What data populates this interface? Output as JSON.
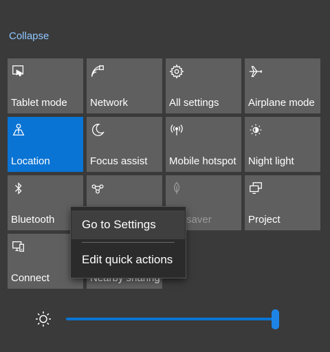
{
  "header": {
    "collapse_label": "Collapse"
  },
  "tiles": [
    {
      "label": "Tablet mode",
      "icon": "tablet-mode-icon",
      "state": "normal"
    },
    {
      "label": "Network",
      "icon": "network-icon",
      "state": "normal"
    },
    {
      "label": "All settings",
      "icon": "gear-icon",
      "state": "normal"
    },
    {
      "label": "Airplane mode",
      "icon": "airplane-icon",
      "state": "normal"
    },
    {
      "label": "Location",
      "icon": "location-icon",
      "state": "active"
    },
    {
      "label": "Focus assist",
      "icon": "moon-icon",
      "state": "normal"
    },
    {
      "label": "Mobile hotspot",
      "icon": "hotspot-icon",
      "state": "normal"
    },
    {
      "label": "Night light",
      "icon": "night-light-icon",
      "state": "normal"
    },
    {
      "label": "Bluetooth",
      "icon": "bluetooth-icon",
      "state": "normal"
    },
    {
      "label": "",
      "icon": "vpn-icon",
      "state": "normal"
    },
    {
      "label": "ery saver",
      "icon": "battery-saver-icon",
      "state": "disabled"
    },
    {
      "label": "Project",
      "icon": "project-icon",
      "state": "normal"
    },
    {
      "label": "Connect",
      "icon": "connect-icon",
      "state": "normal"
    },
    {
      "label": "Nearby sharing",
      "icon": "",
      "state": "normal"
    }
  ],
  "context_menu": {
    "items": [
      "Go to Settings",
      "Edit quick actions"
    ]
  },
  "brightness": {
    "icon": "brightness-icon",
    "level_percent": 100
  },
  "colors": {
    "background": "#3a3a3a",
    "tile": "#5f5f5f",
    "accent": "#0a74d4",
    "link": "#8fc7ff"
  }
}
